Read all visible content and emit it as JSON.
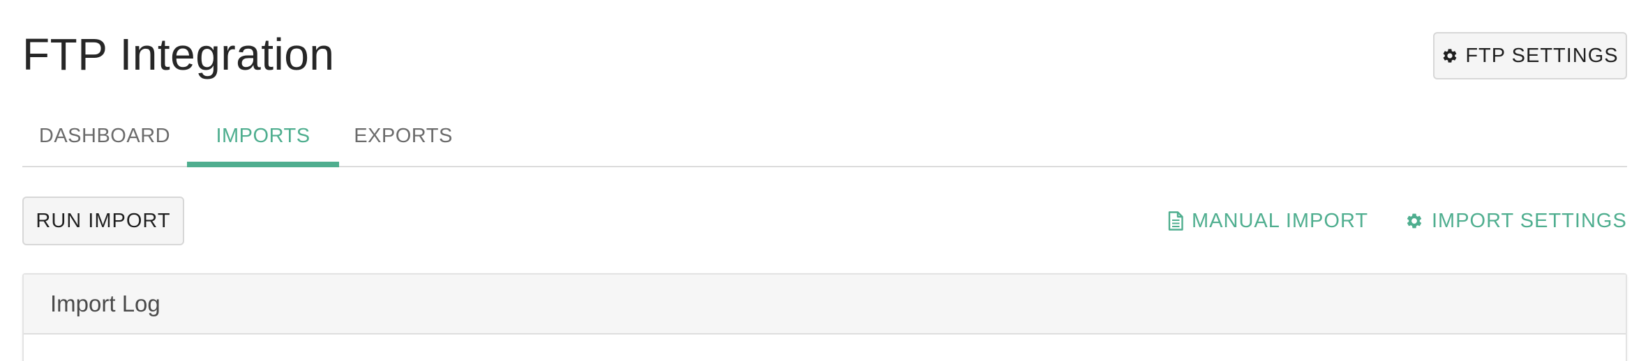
{
  "header": {
    "title": "FTP Integration",
    "settings_button": {
      "label": "FTP SETTINGS",
      "icon": "gear-icon"
    }
  },
  "tabs": [
    {
      "label": "DASHBOARD",
      "active": false
    },
    {
      "label": "IMPORTS",
      "active": true
    },
    {
      "label": "EXPORTS",
      "active": false
    }
  ],
  "toolbar": {
    "run_import_label": "RUN IMPORT",
    "manual_import": {
      "label": "MANUAL IMPORT",
      "icon": "document-icon"
    },
    "import_settings": {
      "label": "IMPORT SETTINGS",
      "icon": "gear-icon"
    }
  },
  "panel": {
    "title": "Import Log"
  },
  "colors": {
    "accent": "#4fae8f",
    "button_bg": "#f5f5f5",
    "panel_header_bg": "#f6f6f6",
    "tab_inactive": "#6b6b6b"
  }
}
